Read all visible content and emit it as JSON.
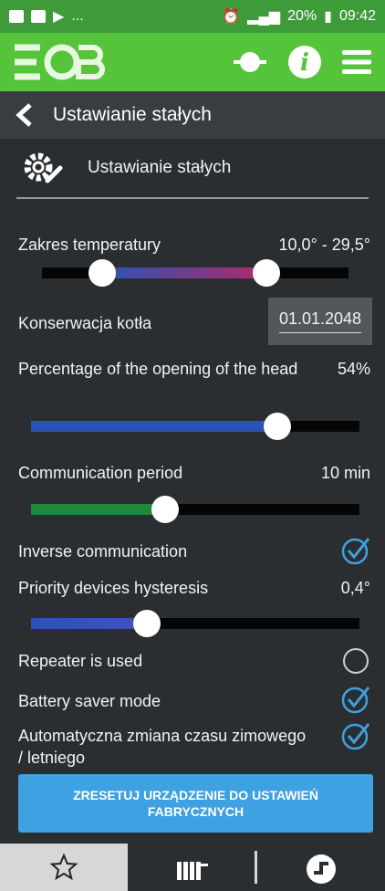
{
  "status": {
    "ellipsis": "...",
    "battery": "20%",
    "time": "09:42"
  },
  "header": {
    "title": "Ustawianie stałych"
  },
  "section": {
    "title": "Ustawianie stałych"
  },
  "rows": {
    "temp_range": {
      "label": "Zakres temperatury",
      "value": "10,0° -  29,5°"
    },
    "boiler": {
      "label": "Konserwacja kotła",
      "value": "01.01.2048"
    },
    "head_opening": {
      "label": "Percentage of the opening of the head",
      "value": "54%"
    },
    "comm_period": {
      "label": "Communication period",
      "value": "10 min"
    },
    "inverse": {
      "label": "Inverse communication",
      "checked": true
    },
    "hysteresis": {
      "label": "Priority devices hysteresis",
      "value": "0,4°"
    },
    "repeater": {
      "label": "Repeater is used",
      "checked": false
    },
    "battery_saver": {
      "label": "Battery saver mode",
      "checked": true
    },
    "auto_time": {
      "label": "Automatyczna zmiana czasu zimowego / letniego",
      "checked": true
    }
  },
  "reset_button": {
    "label": "ZRESETUJ URZĄDZENIE DO USTAWIEŃ FABRYCZNYCH"
  },
  "colors": {
    "appbar": "#55c43a",
    "statusbar": "#3e9b3a",
    "accent": "#3ea1e2",
    "slider_blue": "#2a53b5",
    "slider_green": "#1f8a3b",
    "slider_purple": "#b02a6a"
  }
}
